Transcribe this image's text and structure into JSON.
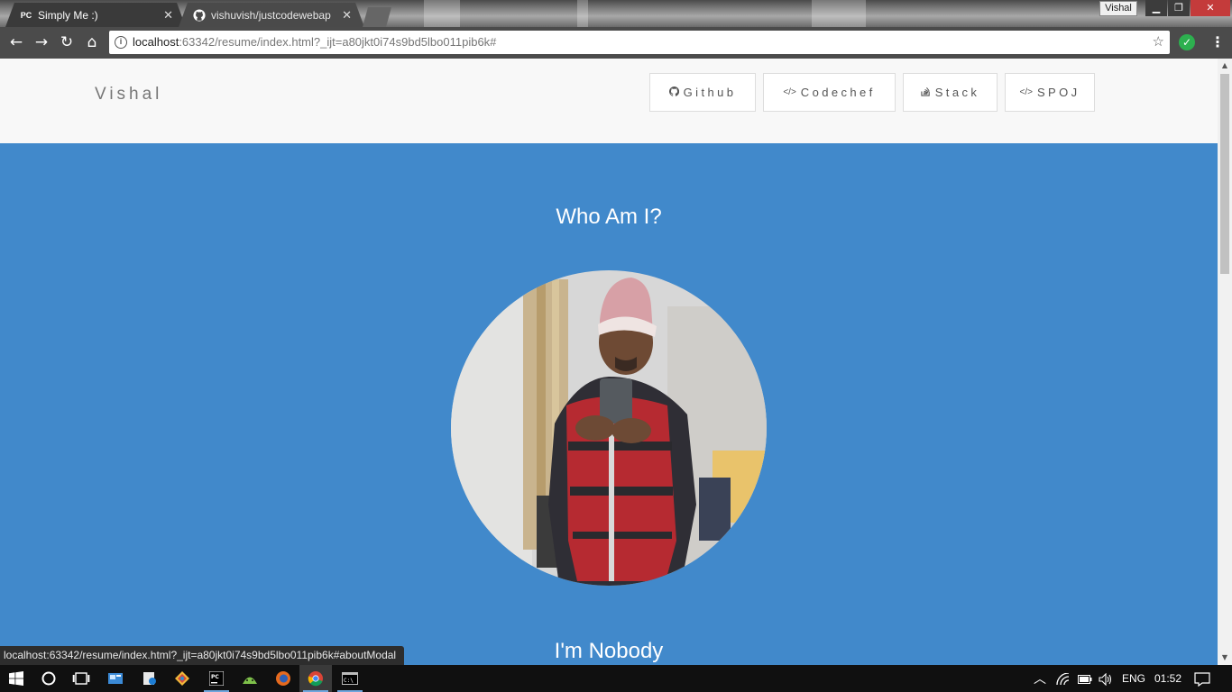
{
  "browser": {
    "tabs": [
      {
        "title": "Simply Me :)",
        "favicon": "PC"
      },
      {
        "title": "vishuvish/justcodewebap",
        "favicon": "github-icon"
      }
    ],
    "profile_name": "Vishal",
    "url": {
      "host": "localhost",
      "rest": ":63342/resume/index.html?_ijt=a80jkt0i74s9bd5lbo011pib6k#"
    },
    "status_text": "localhost:63342/resume/index.html?_ijt=a80jkt0i74s9bd5lbo011pib6k#aboutModal"
  },
  "site": {
    "brand": "Vishal",
    "nav_links": [
      {
        "label": "Github",
        "icon": "github-icon"
      },
      {
        "label": "Codechef",
        "icon": "code-icon"
      },
      {
        "label": "Stack",
        "icon": "stack-overflow-icon"
      },
      {
        "label": "SPOJ",
        "icon": "code-icon"
      }
    ],
    "hero": {
      "heading": "Who Am I?",
      "subheading": "I'm Nobody",
      "accent_color": "#4189cb"
    }
  },
  "taskbar": {
    "language": "ENG",
    "time": "01:52"
  }
}
